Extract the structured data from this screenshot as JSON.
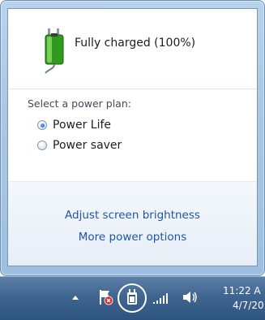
{
  "flyout": {
    "battery_status": "Fully charged (100%)",
    "battery_icon": "battery-plugged-icon",
    "plan_heading": "Select a power plan:",
    "plans": [
      {
        "label": "Power Life",
        "selected": true
      },
      {
        "label": "Power saver",
        "selected": false
      }
    ],
    "links": [
      "Adjust screen brightness",
      "More power options"
    ]
  },
  "taskbar": {
    "icons": [
      "show-hidden-icons-arrow",
      "action-center-flag-icon",
      "power-icon",
      "network-signal-icon",
      "volume-icon"
    ],
    "clock_time": "11:22 A",
    "clock_date": "4/7/20"
  },
  "colors": {
    "link": "#1d56a6",
    "taskbar": "#3f6590",
    "frame": "#a9c8e6"
  }
}
